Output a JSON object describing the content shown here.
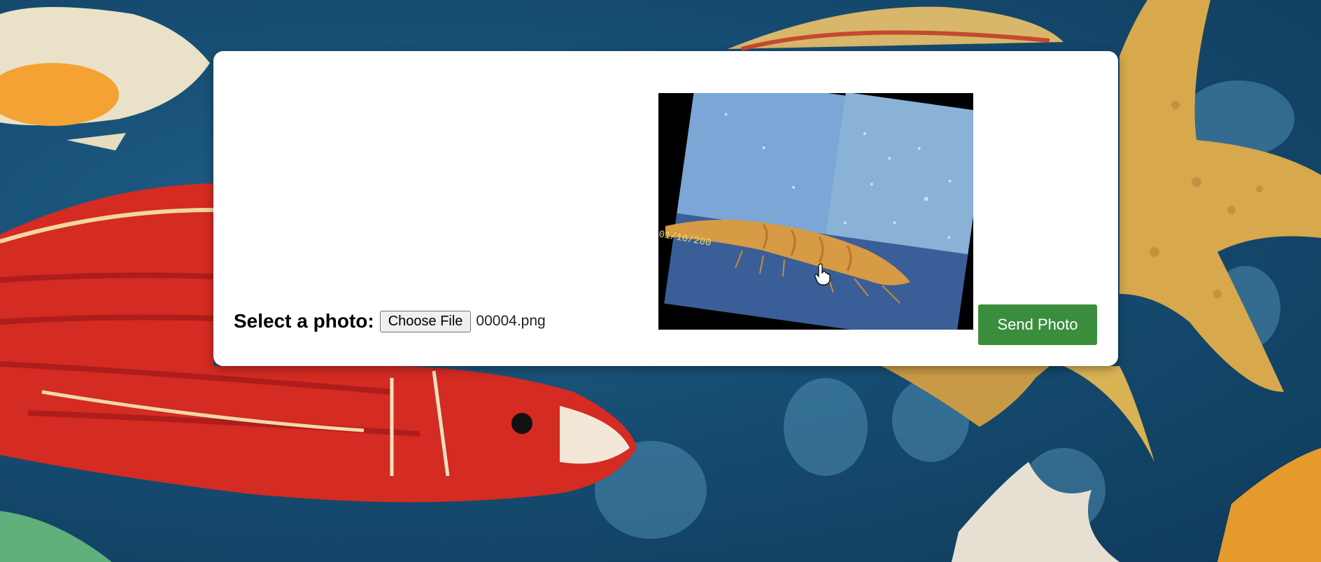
{
  "upload_form": {
    "label": "Select a photo:",
    "choose_file_label": "Choose File",
    "file_name": "00004.png",
    "send_button_label": "Send Photo"
  },
  "preview": {
    "stamp_text": "01/10/200"
  },
  "colors": {
    "send_button": "#3b8d3e",
    "card": "#ffffff",
    "background": "#164d72"
  }
}
